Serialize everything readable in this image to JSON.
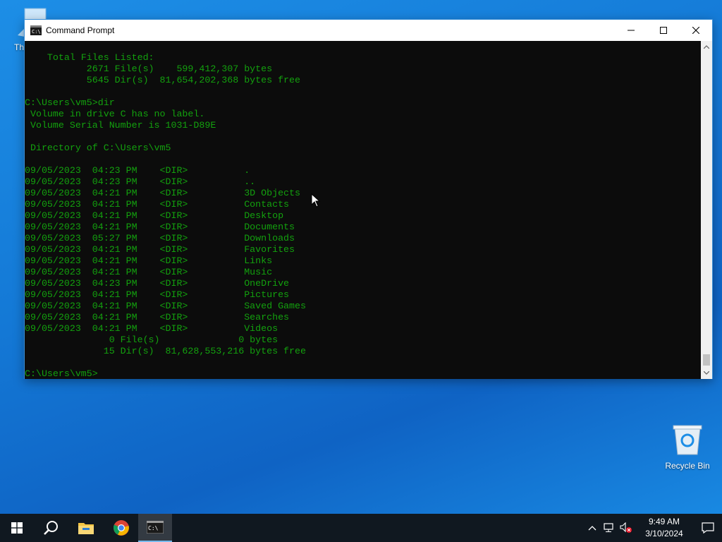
{
  "desktop": {
    "this_pc_label": "Th",
    "recycle_bin_label": "Recycle Bin"
  },
  "window": {
    "title": "Command Prompt"
  },
  "console": {
    "lines": [
      "    Total Files Listed:",
      "           2671 File(s)    599,412,307 bytes",
      "           5645 Dir(s)  81,654,202,368 bytes free",
      "",
      "C:\\Users\\vm5>dir",
      " Volume in drive C has no label.",
      " Volume Serial Number is 1031-D89E",
      "",
      " Directory of C:\\Users\\vm5",
      "",
      "09/05/2023  04:23 PM    <DIR>          .",
      "09/05/2023  04:23 PM    <DIR>          ..",
      "09/05/2023  04:21 PM    <DIR>          3D Objects",
      "09/05/2023  04:21 PM    <DIR>          Contacts",
      "09/05/2023  04:21 PM    <DIR>          Desktop",
      "09/05/2023  04:21 PM    <DIR>          Documents",
      "09/05/2023  05:27 PM    <DIR>          Downloads",
      "09/05/2023  04:21 PM    <DIR>          Favorites",
      "09/05/2023  04:21 PM    <DIR>          Links",
      "09/05/2023  04:21 PM    <DIR>          Music",
      "09/05/2023  04:23 PM    <DIR>          OneDrive",
      "09/05/2023  04:21 PM    <DIR>          Pictures",
      "09/05/2023  04:21 PM    <DIR>          Saved Games",
      "09/05/2023  04:21 PM    <DIR>          Searches",
      "09/05/2023  04:21 PM    <DIR>          Videos",
      "               0 File(s)              0 bytes",
      "              15 Dir(s)  81,628,553,216 bytes free",
      "",
      "C:\\Users\\vm5>"
    ],
    "text_color": "#13a10e",
    "background_color": "#0c0c0c"
  },
  "taskbar": {
    "start_icon": "windows-logo-icon",
    "search_icon": "search-icon",
    "pinned": [
      "file-explorer-icon",
      "chrome-icon",
      "command-prompt-icon"
    ],
    "tray_icons": [
      "chevron-up-icon",
      "network-icon",
      "volume-muted-icon"
    ],
    "clock": {
      "time": "9:49 AM",
      "date": "3/10/2024"
    },
    "notification_icon": "action-center-icon"
  }
}
